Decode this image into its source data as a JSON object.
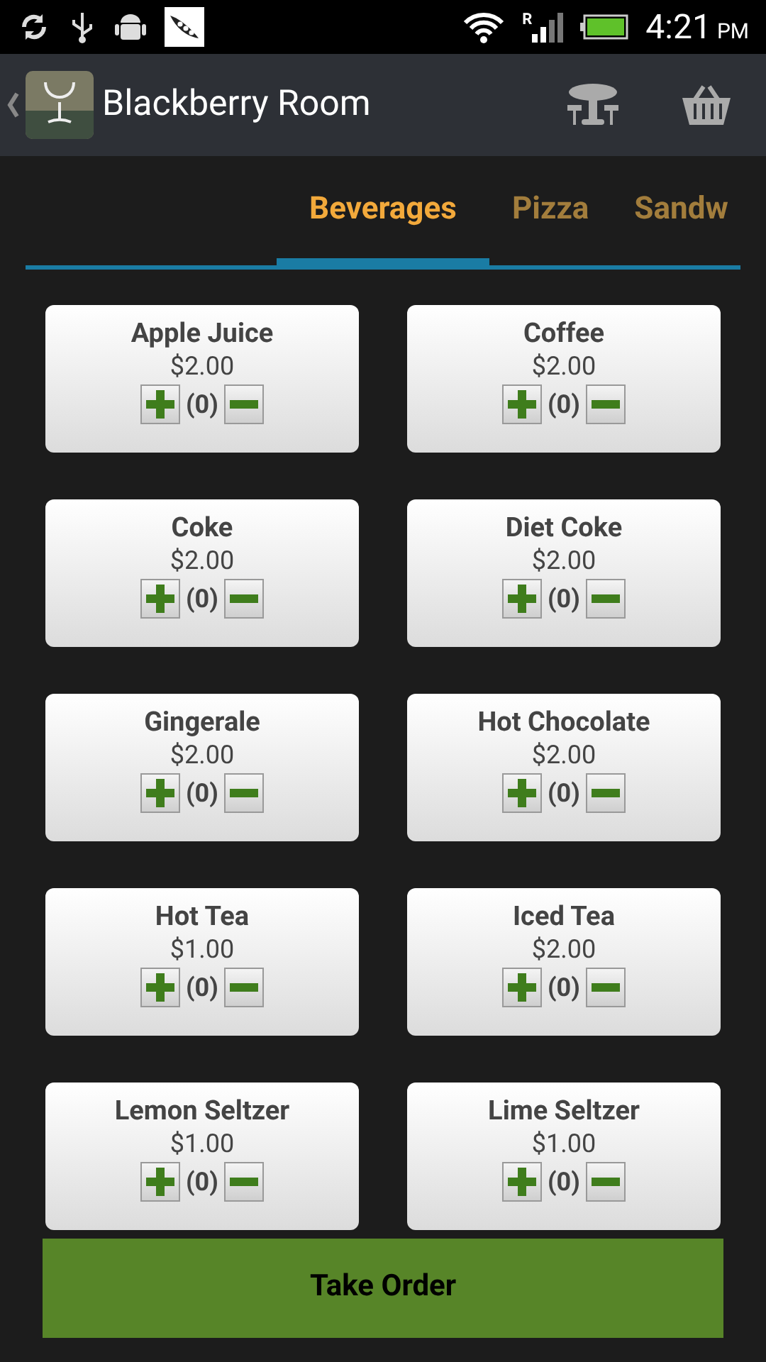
{
  "status_bar": {
    "time": "4:21",
    "ampm": "PM",
    "roaming": "R"
  },
  "action_bar": {
    "title": "Blackberry Room"
  },
  "tabs": [
    {
      "label": "Beverages",
      "selected": true
    },
    {
      "label": "Pizza",
      "selected": false
    },
    {
      "label": "Sandw",
      "selected": false
    }
  ],
  "items": [
    {
      "name": "Apple Juice",
      "price": "$2.00",
      "count": "(0)"
    },
    {
      "name": "Coffee",
      "price": "$2.00",
      "count": "(0)"
    },
    {
      "name": "Coke",
      "price": "$2.00",
      "count": "(0)"
    },
    {
      "name": "Diet Coke",
      "price": "$2.00",
      "count": "(0)"
    },
    {
      "name": "Gingerale",
      "price": "$2.00",
      "count": "(0)"
    },
    {
      "name": "Hot Chocolate",
      "price": "$2.00",
      "count": "(0)"
    },
    {
      "name": "Hot Tea",
      "price": "$1.00",
      "count": "(0)"
    },
    {
      "name": "Iced Tea",
      "price": "$2.00",
      "count": "(0)"
    },
    {
      "name": "Lemon Seltzer",
      "price": "$1.00",
      "count": "(0)"
    },
    {
      "name": "Lime Seltzer",
      "price": "$1.00",
      "count": "(0)"
    }
  ],
  "take_order_button": "Take Order"
}
